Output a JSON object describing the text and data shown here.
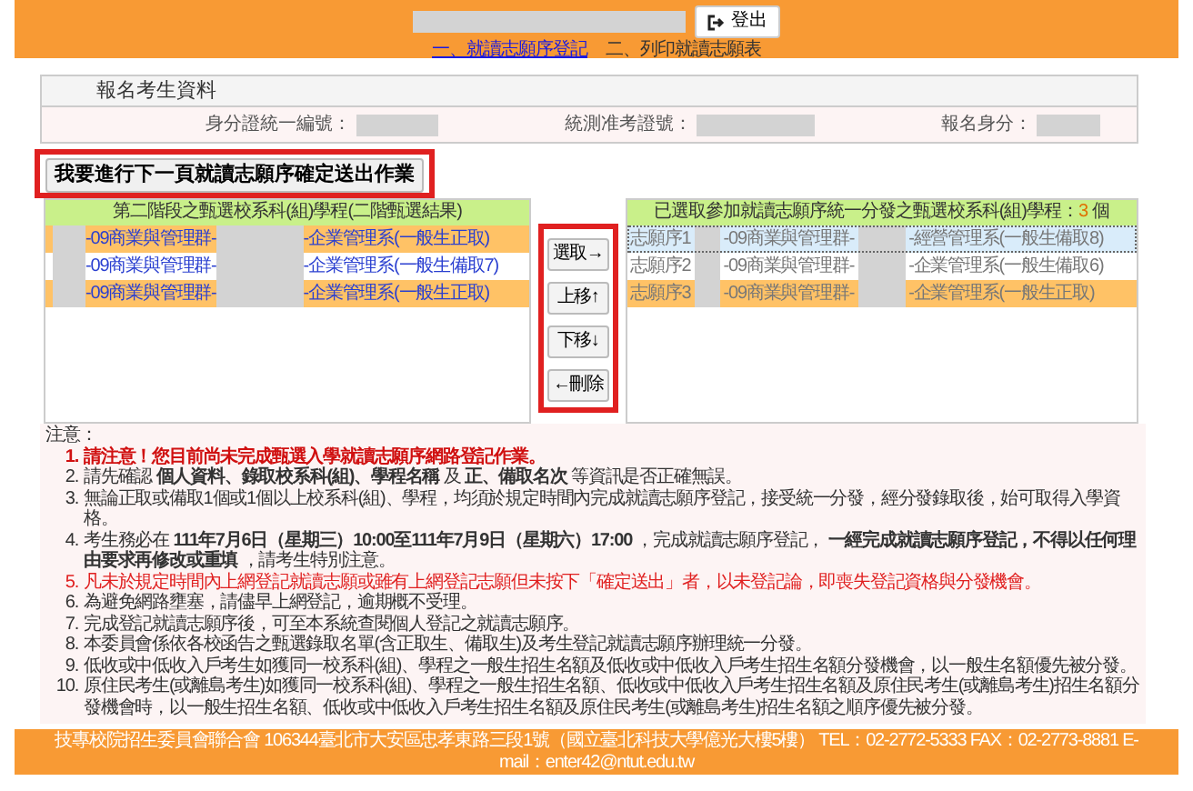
{
  "header": {
    "logout_button": "登出",
    "steps": [
      {
        "label": "一、就讀志願序登記",
        "selected": true
      },
      {
        "label": "二、列印就讀志願表",
        "selected": false
      }
    ]
  },
  "student_panel": {
    "title": "報名考生資料",
    "fields": [
      {
        "label": "身分證統一編號："
      },
      {
        "label": "統測准考證號："
      },
      {
        "label": "報名身分："
      }
    ]
  },
  "submit_button": "我要進行下一頁就讀志願序確定送出作業",
  "available_list": {
    "title": "第二階段之甄選校系科(組)學程(二階甄選結果)",
    "rows": [
      {
        "group": "-09商業與管理群-",
        "department": "-企業管理系(一般生正取)",
        "color": "#ffc266",
        "selected": false
      },
      {
        "group": "-09商業與管理群-",
        "department": "-企業管理系(一般生備取7)",
        "color": "#ffffff",
        "selected": false
      },
      {
        "group": "-09商業與管理群-",
        "department": "-企業管理系(一般生正取)",
        "color": "#ffc266",
        "selected": false
      }
    ]
  },
  "actions": [
    "選取→",
    "上移↑",
    "下移↓",
    "←刪除"
  ],
  "chosen_list": {
    "title": "已選取參加就讀志願序統一分發之甄選校系科(組)學程：",
    "count": "3",
    "count_unit": "個",
    "rows": [
      {
        "order": "志願序1",
        "group": "-09商業與管理群-",
        "department": "-經營管理系(一般生備取8)",
        "color": "#d9ecfa",
        "selected": true
      },
      {
        "order": "志願序2",
        "group": "-09商業與管理群-",
        "department": "-企業管理系(一般生備取6)",
        "color": "#ffffff",
        "selected": false
      },
      {
        "order": "志願序3",
        "group": "-09商業與管理群-",
        "department": "-企業管理系(一般生正取)",
        "color": "#ffc266",
        "selected": false
      }
    ]
  },
  "notes": {
    "title": "注意：",
    "items": [
      {
        "number": "1.",
        "text": "**請注意！您目前尚未完成甄選入學就讀志願序網路登記作業。**",
        "kind": "alert"
      },
      {
        "number": "2.",
        "text": "請先確認 **個人資料、錄取校系科(組)、學程名稱** 及 **正、備取名次** 等資訊是否正確無誤。",
        "kind": "plain"
      },
      {
        "number": "3.",
        "text": "無論正取或備取1個或1個以上校系科(組)、學程，均須於規定時間內完成就讀志願序登記，接受統一分發，經分發錄取後，始可取得入學資格。",
        "kind": "plain"
      },
      {
        "number": "4.",
        "text": "考生務必在 **111年7月6日（星期三）10:00至111年7月9日（星期六）17:00** ，完成就讀志願序登記， **一經完成就讀志願序登記，不得以任何理由要求再修改或重填** ，請考生特別注意。",
        "kind": "plain"
      },
      {
        "number": "5.",
        "text": "凡未於規定時間內上網登記就讀志願或雖有上網登記志願但未按下「確定送出」者，以未登記論，即喪失登記資格與分發機會。",
        "kind": "warning"
      },
      {
        "number": "6.",
        "text": "為避免網路壅塞，請儘早上網登記，逾期概不受理。",
        "kind": "plain"
      },
      {
        "number": "7.",
        "text": "完成登記就讀志願序後，可至本系統查閱個人登記之就讀志願序。",
        "kind": "plain"
      },
      {
        "number": "8.",
        "text": "本委員會係依各校函告之甄選錄取名單(含正取生、備取生)及考生登記就讀志願序辦理統一分發。",
        "kind": "plain"
      },
      {
        "number": "9.",
        "text": "低收或中低收入戶考生如獲同一校系科(組)、學程之一般生招生名額及低收或中低收入戶考生招生名額分發機會，以一般生名額優先被分發。",
        "kind": "plain"
      },
      {
        "number": "10.",
        "text": "原住民考生(或離島考生)如獲同一校系科(組)、學程之一般生招生名額、低收或中低收入戶考生招生名額及原住民考生(或離島考生)招生名額分發機會時，以一般生招生名額、低收或中低收入戶考生招生名額及原住民考生(或離島考生)招生名額之順序優先被分發。",
        "kind": "plain"
      }
    ]
  },
  "footer": "技專校院招生委員會聯合會 106344臺北市大安區忠孝東路三段1號（國立臺北科技大學億光大樓5樓） TEL：02-2772-5333 FAX：02-2773-8881 E-mail：enter42@ntut.edu.tw"
}
